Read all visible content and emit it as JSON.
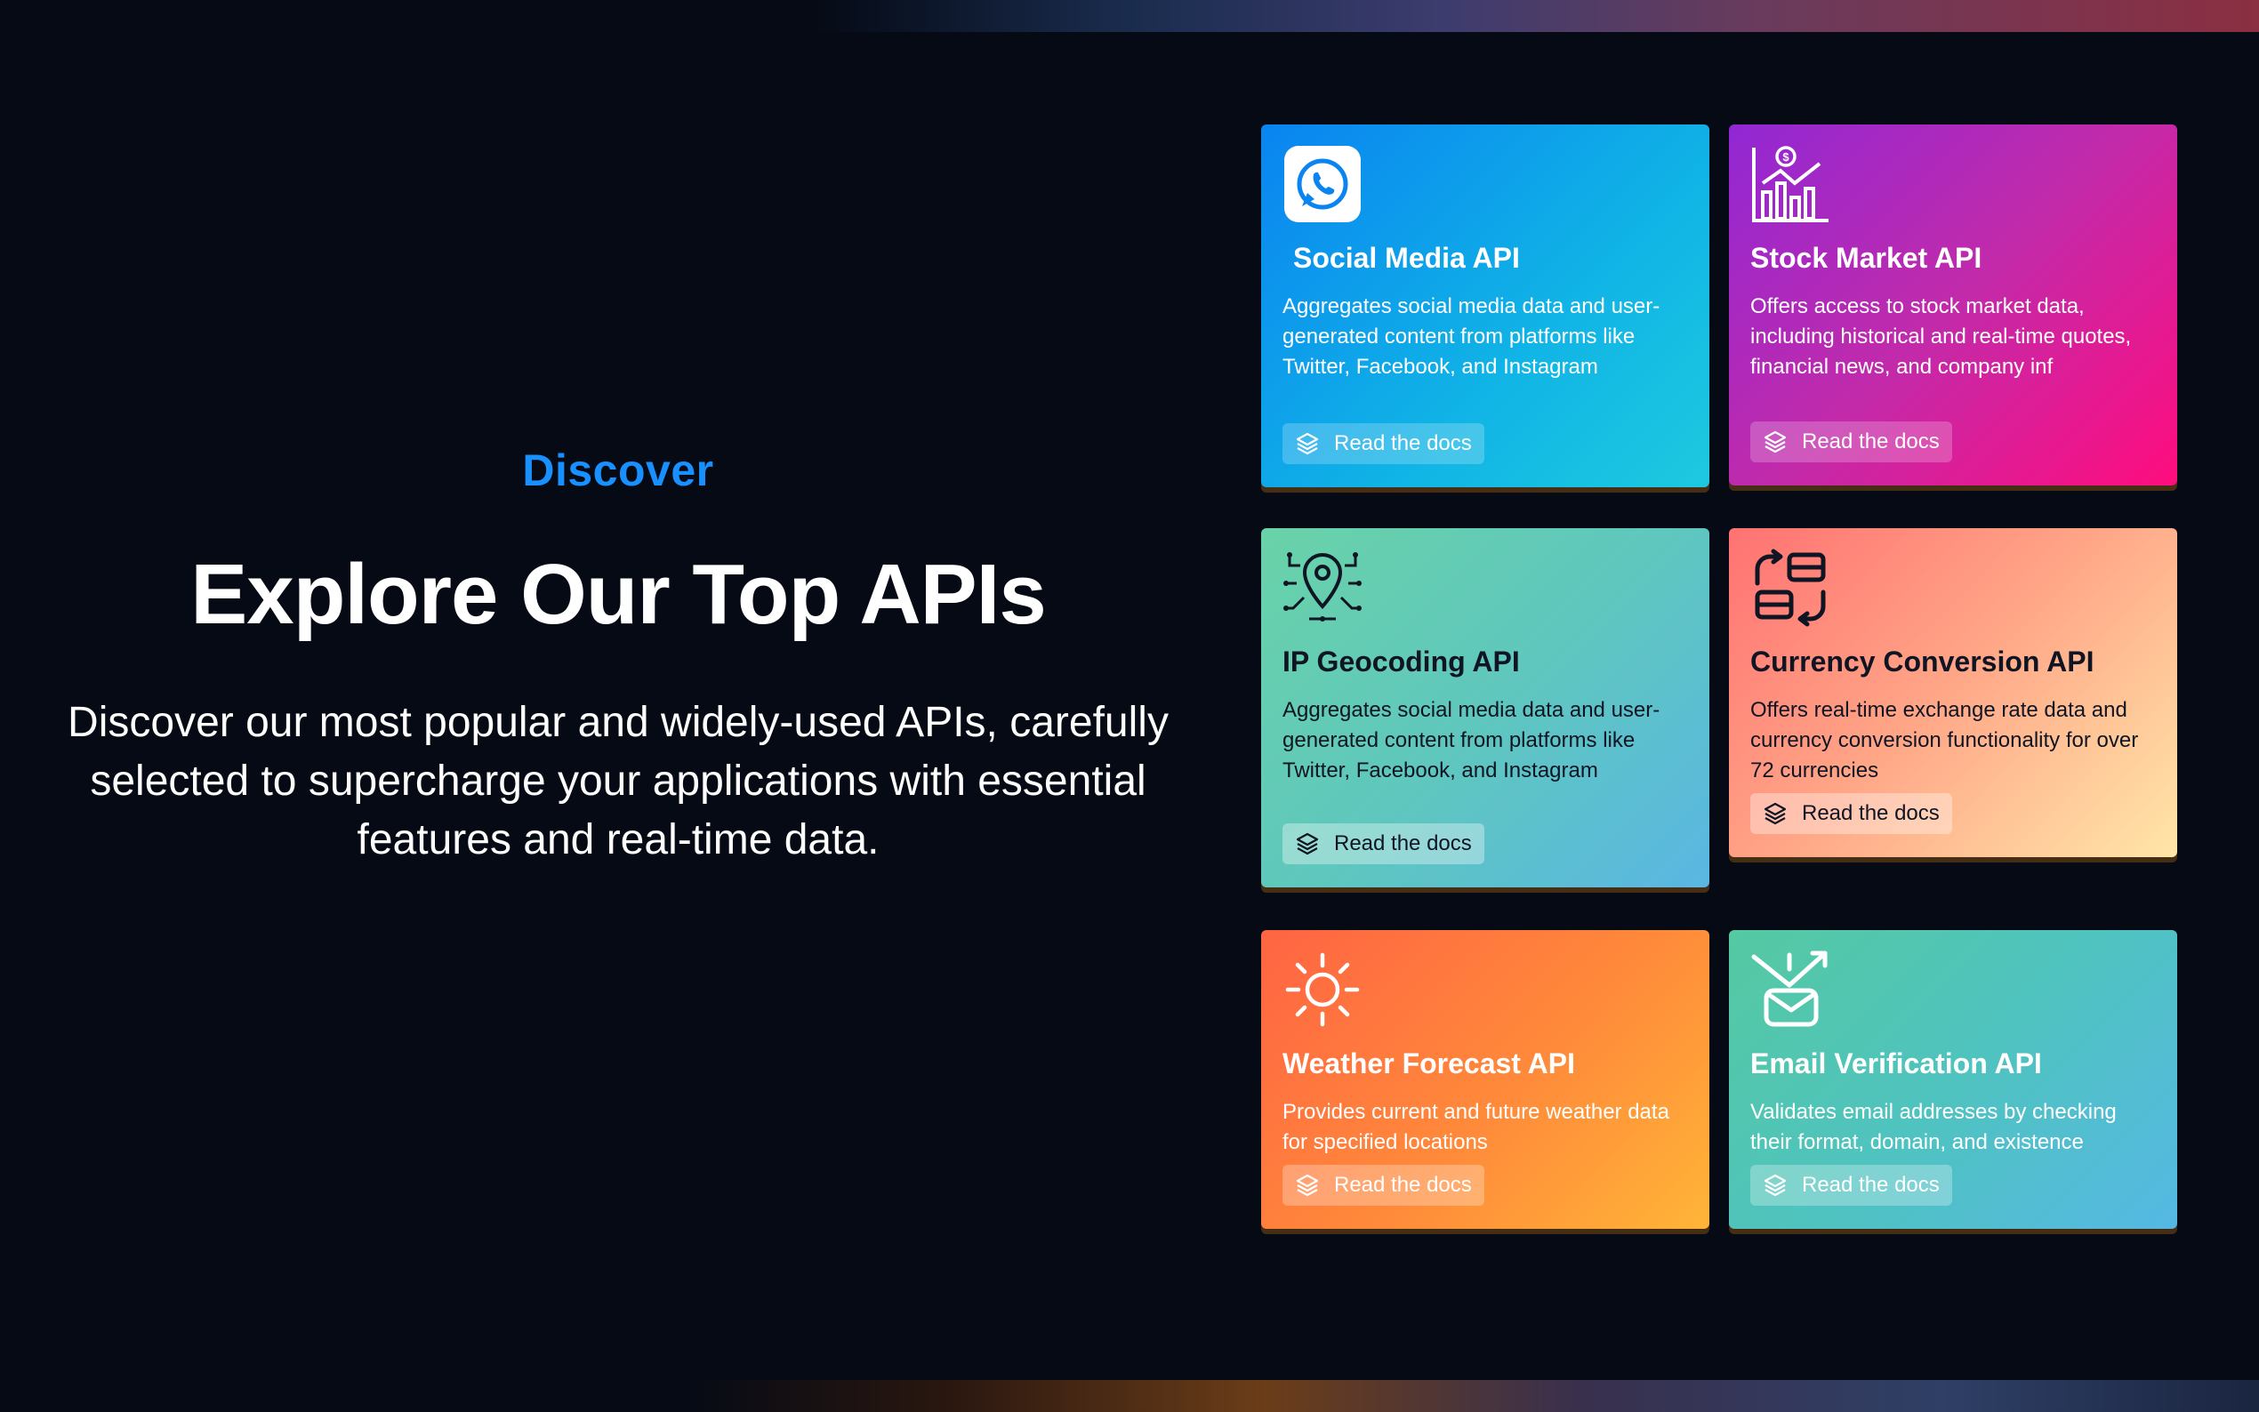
{
  "hero": {
    "eyebrow": "Discover",
    "title": "Explore Our Top APIs",
    "description": "Discover our most popular and widely-used APIs, carefully selected to supercharge your applications with essential features and real-time data."
  },
  "colors": {
    "background": "#050a15",
    "accent": "#1890ff"
  },
  "cards": [
    {
      "icon": "whatsapp-icon",
      "title": "Social Media API",
      "description": "Aggregates social media data and user-generated content from platforms like Twitter, Facebook, and Instagram",
      "button": "Read the docs"
    },
    {
      "icon": "stock-chart-icon",
      "title": "Stock Market API",
      "description": "Offers access to stock market data, including historical and real-time quotes, financial news, and company inf",
      "button": "Read the docs"
    },
    {
      "icon": "location-pin-circuit-icon",
      "title": "IP Geocoding API",
      "description": "Aggregates social media data and user-generated content from platforms like Twitter, Facebook, and Instagram",
      "button": "Read the docs"
    },
    {
      "icon": "currency-exchange-icon",
      "title": "Currency Conversion API",
      "description": "Offers real-time exchange rate data and currency conversion functionality for over 72 currencies",
      "button": "Read the docs"
    },
    {
      "icon": "sun-icon",
      "title": "Weather Forecast API",
      "description": "Provides current and future weather data for specified locations",
      "button": "Read the docs"
    },
    {
      "icon": "email-check-icon",
      "title": "Email Verification API",
      "description": "Validates email addresses by checking their format, domain, and existence",
      "button": "Read the docs"
    }
  ]
}
